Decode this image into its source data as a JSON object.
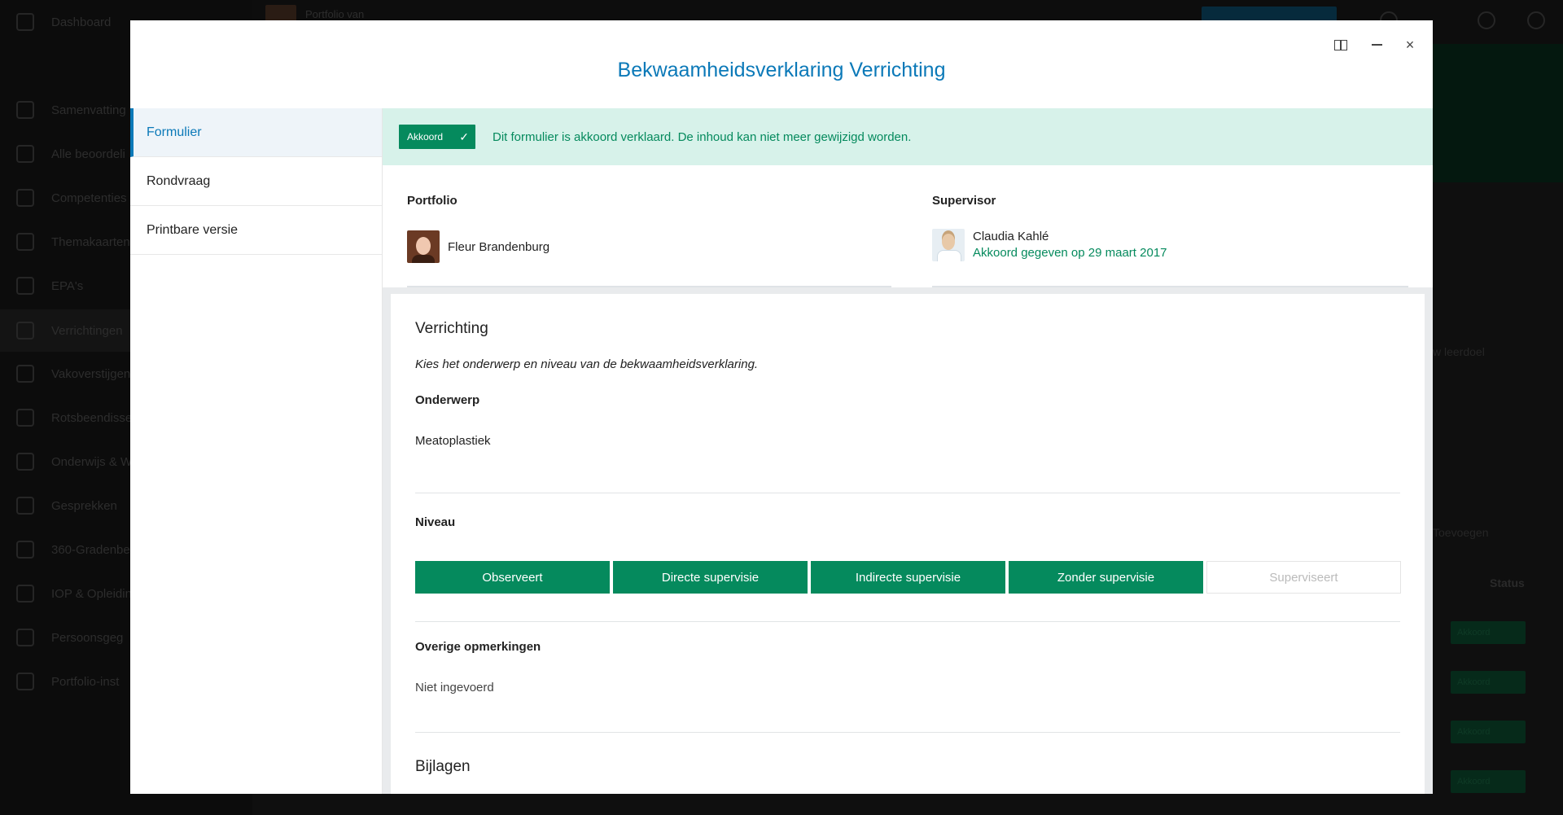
{
  "background": {
    "sidebar_items": [
      "Dashboard",
      "Samenvatting",
      "Alle beoordeli",
      "Competenties",
      "Themakaarten",
      "EPA's",
      "Verrichtingen",
      "Vakoverstijgen",
      "Rotsbeendisse",
      "Onderwijs & W",
      "Gesprekken",
      "360-Gradenbe",
      "IOP & Opleidin",
      "Persoonsgeg",
      "Portfolio-inst"
    ],
    "portfolio_label": "Portfolio van",
    "links": [
      "w leerdoel",
      "Toevoegen"
    ],
    "status_header": "Status",
    "badges": [
      "Akkoord",
      "Akkoord",
      "Akkoord",
      "Akkoord"
    ]
  },
  "modal": {
    "title": "Bekwaamheidsverklaring Verrichting",
    "controls": {
      "split": "split-view",
      "minimize": "minimize",
      "close": "×"
    }
  },
  "nav": [
    "Formulier",
    "Rondvraag",
    "Printbare versie"
  ],
  "banner": {
    "badge": "Akkoord",
    "badge_icon": "✓",
    "message": "Dit formulier is akkoord verklaard. De inhoud kan niet meer gewijzigd worden."
  },
  "portfolio": {
    "label": "Portfolio",
    "name": "Fleur Brandenburg"
  },
  "supervisor": {
    "label": "Supervisor",
    "name": "Claudia Kahlé",
    "status": "Akkoord gegeven op 29 maart 2017"
  },
  "form": {
    "section_title": "Verrichting",
    "hint": "Kies het onderwerp en niveau van de bekwaamheidsverklaring.",
    "onderwerp_label": "Onderwerp",
    "onderwerp_value": "Meatoplastiek",
    "niveau_label": "Niveau",
    "levels": [
      "Observeert",
      "Directe supervisie",
      "Indirecte supervisie",
      "Zonder supervisie",
      "Superviseert"
    ],
    "selected_level_count": 4,
    "opmerkingen_label": "Overige opmerkingen",
    "opmerkingen_value": "Niet ingevoerd",
    "bijlagen_title": "Bijlagen"
  },
  "colors": {
    "accent_blue": "#0b79b8",
    "green": "#058a5d",
    "banner_bg": "#d7f2ea"
  }
}
